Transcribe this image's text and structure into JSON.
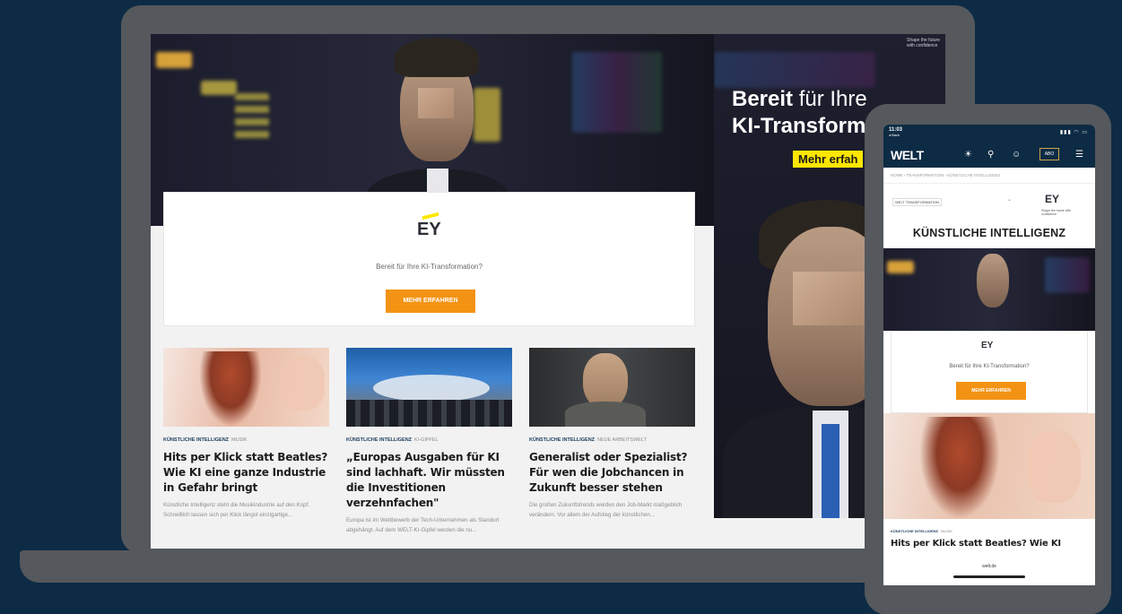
{
  "laptop": {
    "side_ad": {
      "title_bold": "Bereit",
      "title_light": " für Ihre",
      "title_line2": "KI-Transform",
      "cta": "Mehr erfah",
      "tiny_text": "Shape the future with confidence"
    },
    "ey_card": {
      "logo": "EY",
      "tagline": "Bereit für Ihre KI-Transformation?",
      "button": "MEHR ERFAHREN"
    },
    "articles": [
      {
        "category": "KÜNSTLICHE INTELLIGENZ",
        "subcategory": "MUSIK",
        "headline": "Hits per Klick statt Beatles? Wie KI eine ganze Industrie in Gefahr bringt",
        "teaser": "Künstliche Intelligenz steht die Musikindustrie auf den Kopf. Schnelllich lassen sich per Klick längst einzigartige..."
      },
      {
        "category": "KÜNSTLICHE INTELLIGENZ",
        "subcategory": "KI-GIPFEL",
        "headline": "„Europas Ausgaben für KI sind lachhaft. Wir müssten die Investitionen verzehnfachen\"",
        "teaser": "Europa ist im Wettbewerb der Tech-Unternehmen als Standort abgehängt. Auf dem WELT-KI-Gipfel werden die nu..."
      },
      {
        "category": "KÜNSTLICHE INTELLIGENZ",
        "subcategory": "NEUE ARBEITSWELT",
        "headline": "Generalist oder Spezialist? Für wen die Jobchancen in Zukunft besser stehen",
        "teaser": "Die großen Zukunftstrends werden den Job-Markt maßgeblich verändern. Vor allem der Aufstieg der künstlichen..."
      }
    ]
  },
  "phone": {
    "status": {
      "time": "11:03",
      "carrier": "◂ Back",
      "signal": "▮▮▮ ◠ ▭"
    },
    "nav": {
      "logo": "WELT",
      "abo": "ABO"
    },
    "breadcrumb": "HOME  ›  TRANSFORMATION  ›  KÜNSTLICHE INTELLIGENZ",
    "sponsor": {
      "label": "WELT TRANSFORMATION",
      "logo": "EY",
      "tiny": "Shape the future with confidence"
    },
    "section_title": "KÜNSTLICHE INTELLIGENZ",
    "card": {
      "logo": "EY",
      "tagline": "Bereit für Ihre KI-Transformation?",
      "button": "MEHR ERFAHREN"
    },
    "article": {
      "category": "KÜNSTLICHE INTELLIGENZ",
      "subcategory": "MUSIK",
      "headline": "Hits per Klick statt Beatles? Wie KI"
    },
    "url": "welt.de"
  }
}
